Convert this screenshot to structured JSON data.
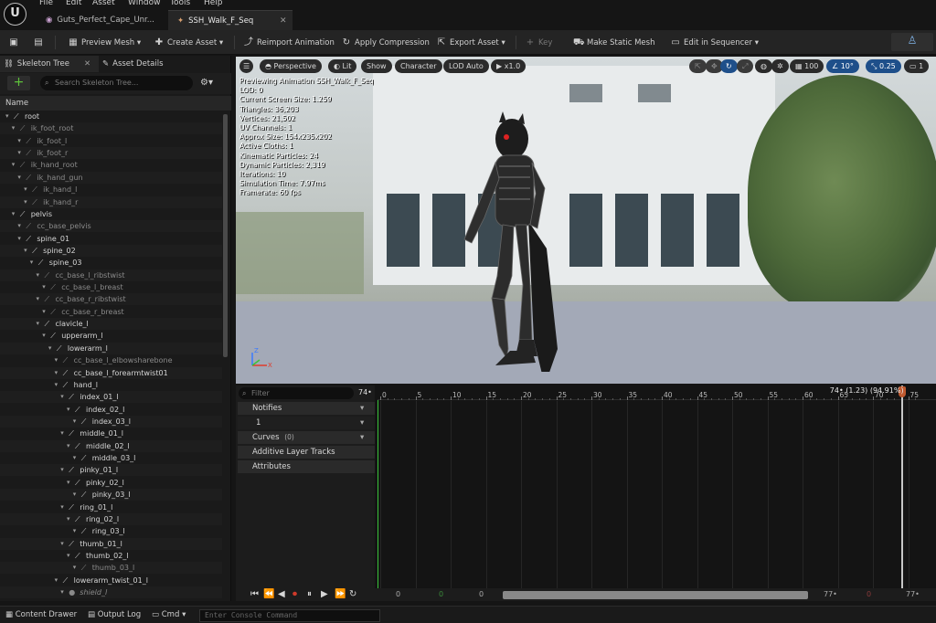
{
  "menu": [
    "File",
    "Edit",
    "Asset",
    "Window",
    "Tools",
    "Help"
  ],
  "tabs": [
    {
      "label": "Guts_Perfect_Cape_Unr...",
      "active": false
    },
    {
      "label": "SSH_Walk_F_Seq",
      "active": true
    }
  ],
  "toolbar": {
    "preview_mesh": "Preview Mesh",
    "create_asset": "Create Asset",
    "reimport_animation": "Reimport Animation",
    "apply_compression": "Apply Compression",
    "export_asset": "Export Asset",
    "key": "Key",
    "make_static_mesh": "Make Static Mesh",
    "edit_in_sequencer": "Edit in Sequencer"
  },
  "left_panel": {
    "tab_skeleton_tree": "Skeleton Tree",
    "tab_asset_details": "Asset Details",
    "search_placeholder": "Search Skeleton Tree...",
    "column_name": "Name",
    "bones": [
      {
        "name": "root",
        "depth": 0,
        "dim": false
      },
      {
        "name": "ik_foot_root",
        "depth": 1,
        "dim": true
      },
      {
        "name": "ik_foot_l",
        "depth": 2,
        "dim": true
      },
      {
        "name": "ik_foot_r",
        "depth": 2,
        "dim": true
      },
      {
        "name": "ik_hand_root",
        "depth": 1,
        "dim": true
      },
      {
        "name": "ik_hand_gun",
        "depth": 2,
        "dim": true
      },
      {
        "name": "ik_hand_l",
        "depth": 3,
        "dim": true
      },
      {
        "name": "ik_hand_r",
        "depth": 3,
        "dim": true
      },
      {
        "name": "pelvis",
        "depth": 1,
        "dim": false
      },
      {
        "name": "cc_base_pelvis",
        "depth": 2,
        "dim": true
      },
      {
        "name": "spine_01",
        "depth": 2,
        "dim": false
      },
      {
        "name": "spine_02",
        "depth": 3,
        "dim": false
      },
      {
        "name": "spine_03",
        "depth": 4,
        "dim": false
      },
      {
        "name": "cc_base_l_ribstwist",
        "depth": 5,
        "dim": true
      },
      {
        "name": "cc_base_l_breast",
        "depth": 6,
        "dim": true
      },
      {
        "name": "cc_base_r_ribstwist",
        "depth": 5,
        "dim": true
      },
      {
        "name": "cc_base_r_breast",
        "depth": 6,
        "dim": true
      },
      {
        "name": "clavicle_l",
        "depth": 5,
        "dim": false
      },
      {
        "name": "upperarm_l",
        "depth": 6,
        "dim": false
      },
      {
        "name": "lowerarm_l",
        "depth": 7,
        "dim": false
      },
      {
        "name": "cc_base_l_elbowsharebone",
        "depth": 8,
        "dim": true
      },
      {
        "name": "cc_base_l_forearmtwist01",
        "depth": 8,
        "dim": false
      },
      {
        "name": "hand_l",
        "depth": 8,
        "dim": false
      },
      {
        "name": "index_01_l",
        "depth": 9,
        "dim": false
      },
      {
        "name": "index_02_l",
        "depth": 10,
        "dim": false
      },
      {
        "name": "index_03_l",
        "depth": 11,
        "dim": false
      },
      {
        "name": "middle_01_l",
        "depth": 9,
        "dim": false
      },
      {
        "name": "middle_02_l",
        "depth": 10,
        "dim": false
      },
      {
        "name": "middle_03_l",
        "depth": 11,
        "dim": false
      },
      {
        "name": "pinky_01_l",
        "depth": 9,
        "dim": false
      },
      {
        "name": "pinky_02_l",
        "depth": 10,
        "dim": false
      },
      {
        "name": "pinky_03_l",
        "depth": 11,
        "dim": false
      },
      {
        "name": "ring_01_l",
        "depth": 9,
        "dim": false
      },
      {
        "name": "ring_02_l",
        "depth": 10,
        "dim": false
      },
      {
        "name": "ring_03_l",
        "depth": 11,
        "dim": false
      },
      {
        "name": "thumb_01_l",
        "depth": 9,
        "dim": false
      },
      {
        "name": "thumb_02_l",
        "depth": 10,
        "dim": false
      },
      {
        "name": "thumb_03_l",
        "depth": 11,
        "dim": true
      },
      {
        "name": "lowerarm_twist_01_l",
        "depth": 8,
        "dim": false
      },
      {
        "name": "shield_l",
        "depth": 9,
        "dim": true,
        "italic": true
      }
    ]
  },
  "viewport": {
    "perspective": "Perspective",
    "lit": "Lit",
    "show": "Show",
    "character": "Character",
    "lod": "LOD Auto",
    "speed": "x1.0",
    "grid": "100",
    "angle": "10°",
    "scale": "0.25",
    "camera_speed": "1",
    "stats": [
      "Previewing Animation SSH_Walk_F_Seq",
      "LOD: 0",
      "Current Screen Size: 1.259",
      "Triangles: 36,203",
      "Vertices: 21,502",
      "UV Channels: 1",
      "Approx Size: 154x235x202",
      "Active Cloths: 1",
      "Kinematic Particles: 24",
      "Dynamic Particles: 2,319",
      "Iterations: 10",
      "Simulation Time: 7.97ms",
      "Framerate: 60 fps"
    ]
  },
  "timeline": {
    "filter_placeholder": "Filter",
    "frame_count": "74•",
    "tracks": {
      "notifies": "Notifies",
      "notify_track": "1",
      "curves": "Curves",
      "curves_count": "(0)",
      "additive_layer_tracks": "Additive Layer Tracks",
      "attributes": "Attributes"
    },
    "ticks": [
      0,
      5,
      10,
      15,
      20,
      25,
      30,
      35,
      40,
      45,
      50,
      55,
      60,
      65,
      70,
      75
    ],
    "max_frame": 77,
    "current_frame": 74,
    "current_label": "74• (1.23) (94.91%)",
    "range": {
      "start_a": "0",
      "start_b": "0",
      "start_c": "0",
      "end_a": "77•",
      "end_b": "77•"
    }
  },
  "statusbar": {
    "content_drawer": "Content Drawer",
    "output_log": "Output Log",
    "cmd": "Cmd",
    "console_placeholder": "Enter Console Command"
  },
  "colors": {
    "accent_blue": "#1e4f8a",
    "add_green": "#5ec23b",
    "record_red": "#d03a2a",
    "playhead_orange": "#c05a30"
  }
}
